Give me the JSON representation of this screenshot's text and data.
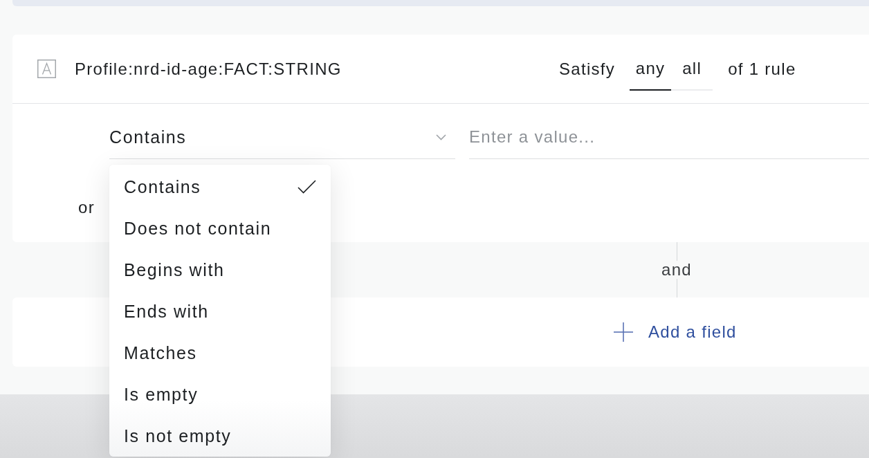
{
  "rule_card": {
    "field_name": "Profile:nrd-id-age:FACT:STRING",
    "satisfy": {
      "label": "Satisfy",
      "options": [
        {
          "label": "any",
          "selected": true
        },
        {
          "label": "all",
          "selected": false
        }
      ],
      "suffix": "of 1 rule"
    },
    "operator_select": {
      "value": "Contains"
    },
    "value_field": {
      "placeholder": "Enter a value..."
    },
    "or_label": "or"
  },
  "connector": {
    "label": "and"
  },
  "add_field": {
    "label": "Add a field"
  },
  "operator_menu": {
    "items": [
      {
        "label": "Contains",
        "selected": true
      },
      {
        "label": "Does not contain",
        "selected": false
      },
      {
        "label": "Begins with",
        "selected": false
      },
      {
        "label": "Ends with",
        "selected": false
      },
      {
        "label": "Matches",
        "selected": false
      },
      {
        "label": "Is empty",
        "selected": false
      },
      {
        "label": "Is not empty",
        "selected": false
      }
    ]
  }
}
